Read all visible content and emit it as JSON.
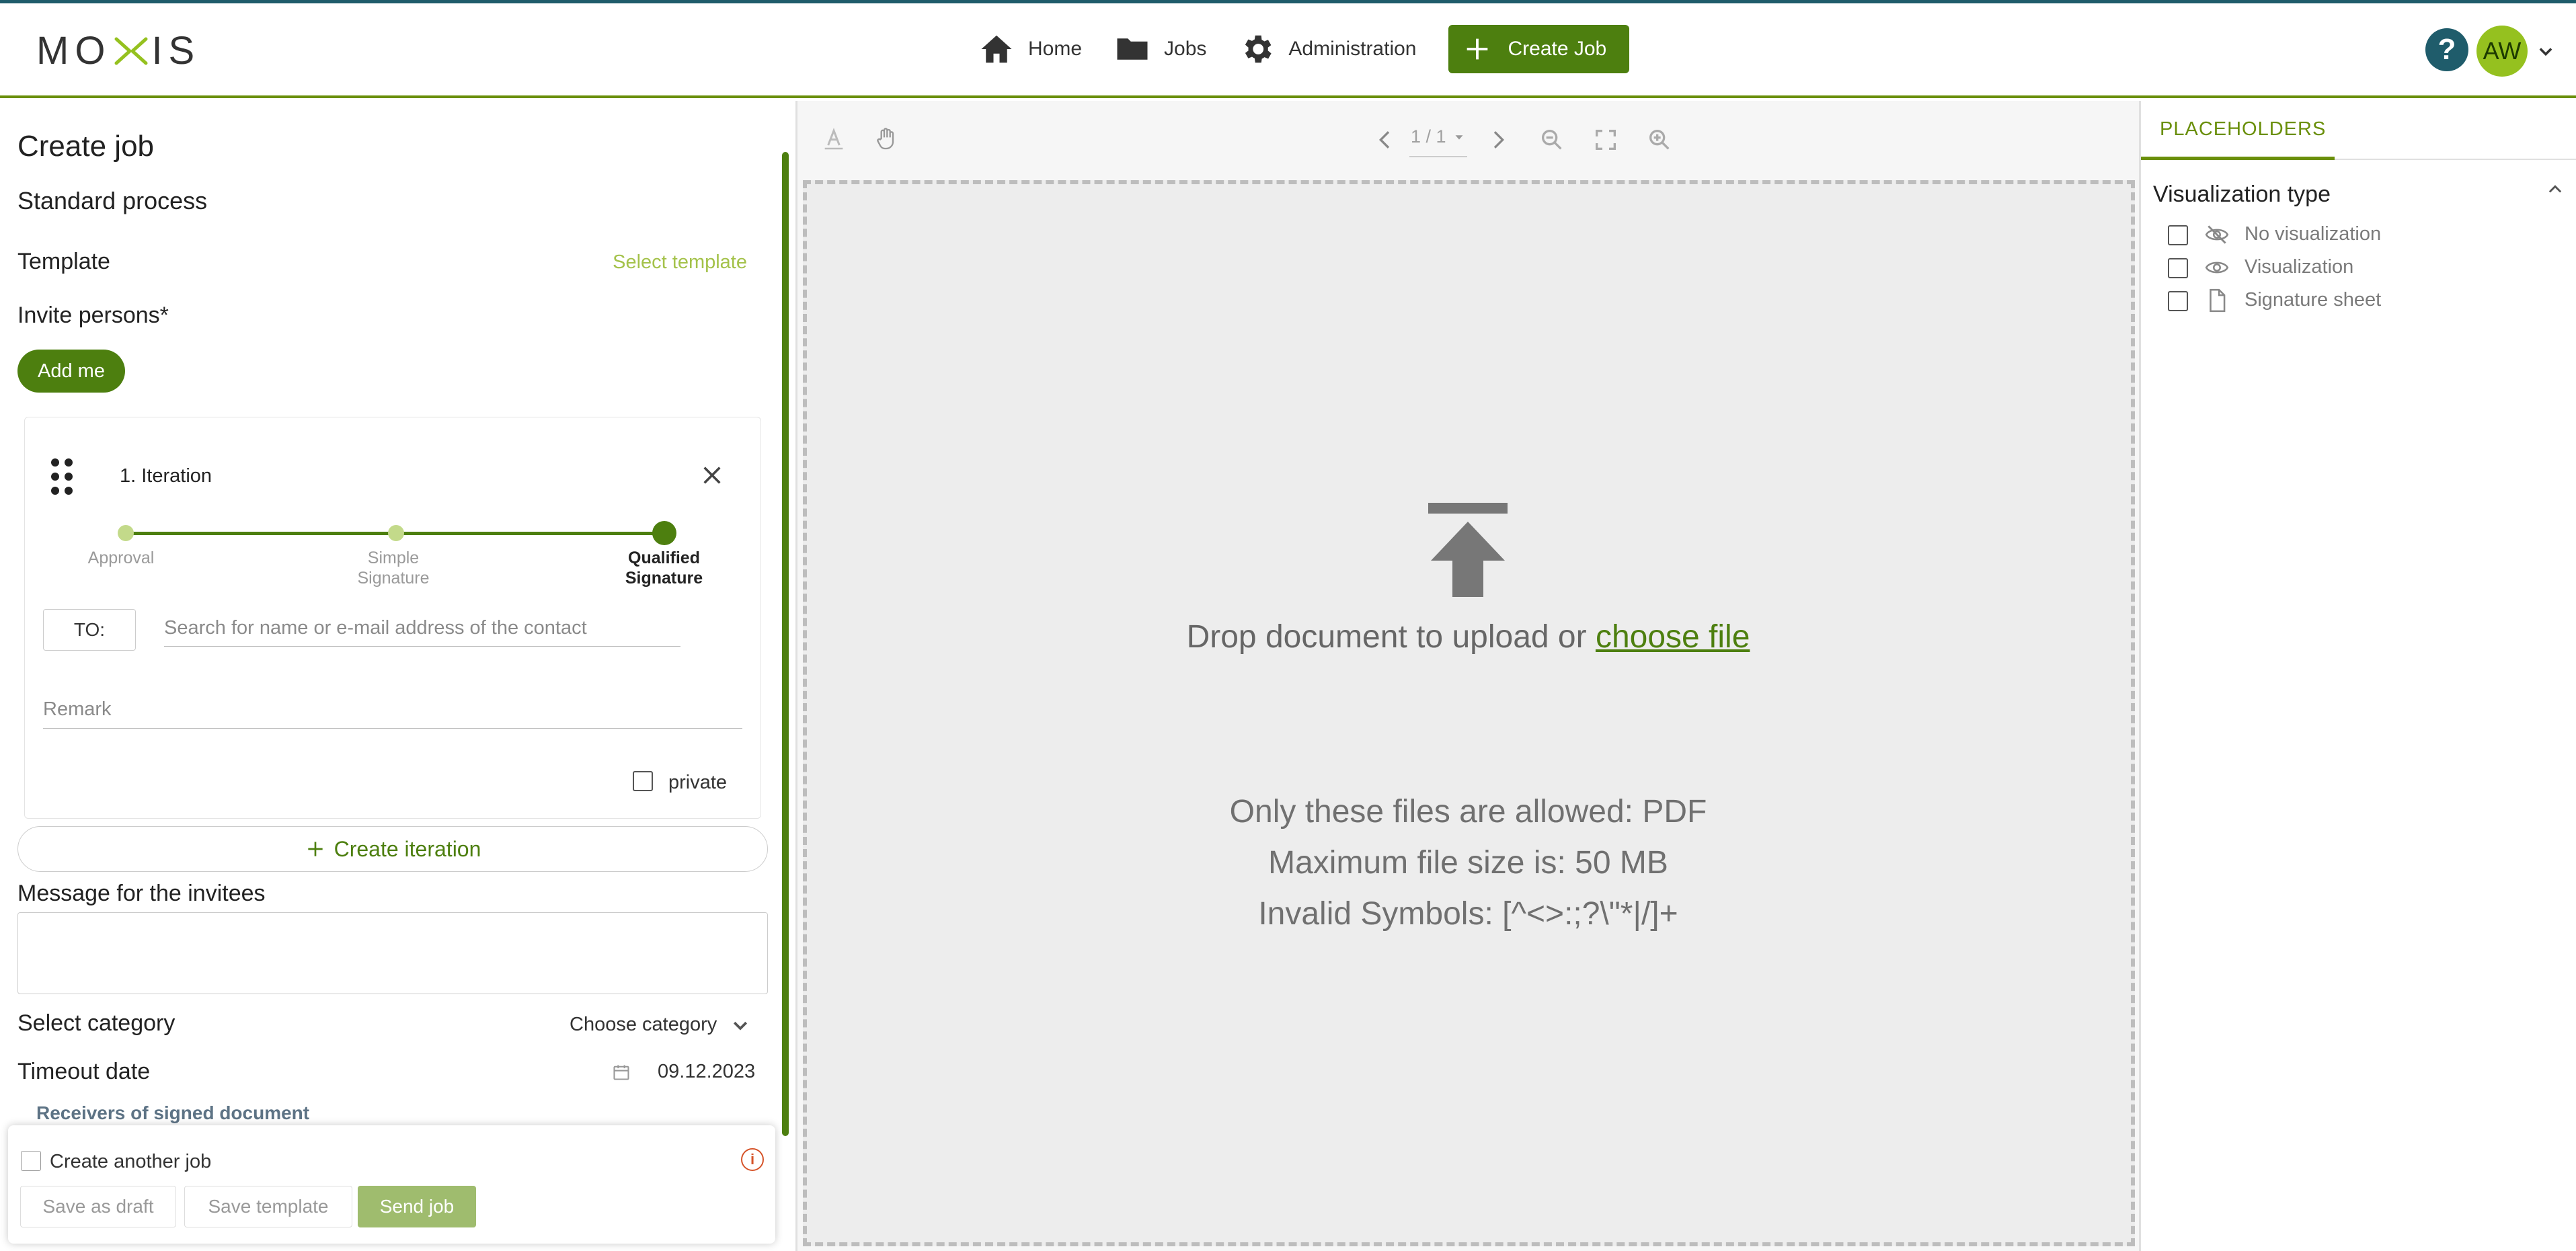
{
  "header": {
    "logo": "MOXIS",
    "nav": [
      {
        "label": "Home",
        "icon": "home-icon"
      },
      {
        "label": "Jobs",
        "icon": "folder-icon"
      },
      {
        "label": "Administration",
        "icon": "gear-icon"
      }
    ],
    "create_job_label": "Create Job",
    "help_symbol": "?",
    "avatar_initials": "AW"
  },
  "left": {
    "title": "Create job",
    "subtitle": "Standard process",
    "template_label": "Template",
    "select_template": "Select template",
    "invite_label": "Invite persons*",
    "add_me": "Add me",
    "iteration": {
      "title": "1. Iteration",
      "stages": [
        {
          "label": "Approval",
          "active": false
        },
        {
          "label": "Simple Signature",
          "active": false
        },
        {
          "label": "Qualified Signature",
          "active": true
        }
      ],
      "to_label": "TO:",
      "search_placeholder": "Search for name or e-mail address of the contact",
      "remark_placeholder": "Remark",
      "private_label": "private"
    },
    "create_iteration": "Create iteration",
    "message_label": "Message for the invitees",
    "category_label": "Select category",
    "category_value": "Choose category",
    "timeout_label": "Timeout date",
    "timeout_value": "09.12.2023",
    "receivers_label": "Receivers of signed document",
    "footer": {
      "create_another": "Create another job",
      "save_draft": "Save as draft",
      "save_template": "Save template",
      "send_job": "Send job"
    }
  },
  "viewer": {
    "page_indicator": "1 / 1",
    "drop_text": "Drop document to upload or",
    "choose_file": "choose file",
    "rules": [
      "Only these files are allowed: PDF",
      "Maximum file size is: 50 MB",
      "Invalid Symbols: [^<>:;?\\\"*|/]+"
    ]
  },
  "right": {
    "tab": "PLACEHOLDERS",
    "section_title": "Visualization type",
    "items": [
      {
        "label": "No visualization",
        "icon": "eye-off-icon"
      },
      {
        "label": "Visualization",
        "icon": "eye-icon"
      },
      {
        "label": "Signature sheet",
        "icon": "document-icon"
      }
    ]
  },
  "colors": {
    "brand_green": "#4d7f0f",
    "accent_line": "#6a8f0a",
    "light_green": "#95c11f",
    "teal": "#1f5c6b"
  }
}
